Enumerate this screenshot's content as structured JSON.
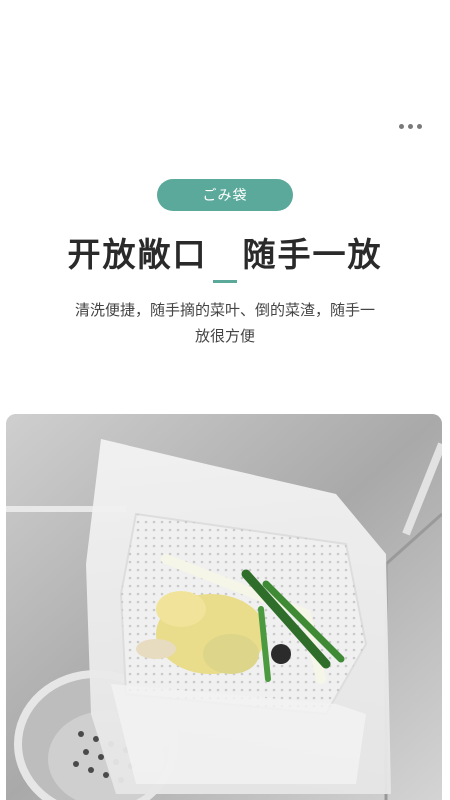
{
  "badge": "ごみ袋",
  "headline": "开放敞口　随手一放",
  "description_line1": "清洗便捷，随手摘的菜叶、倒的菜渣，随手一",
  "description_line2": "放很方便",
  "colors": {
    "accent": "#5aa99b",
    "text": "#2a2a2a"
  },
  "icons": {
    "menu": "more-dots-icon"
  }
}
